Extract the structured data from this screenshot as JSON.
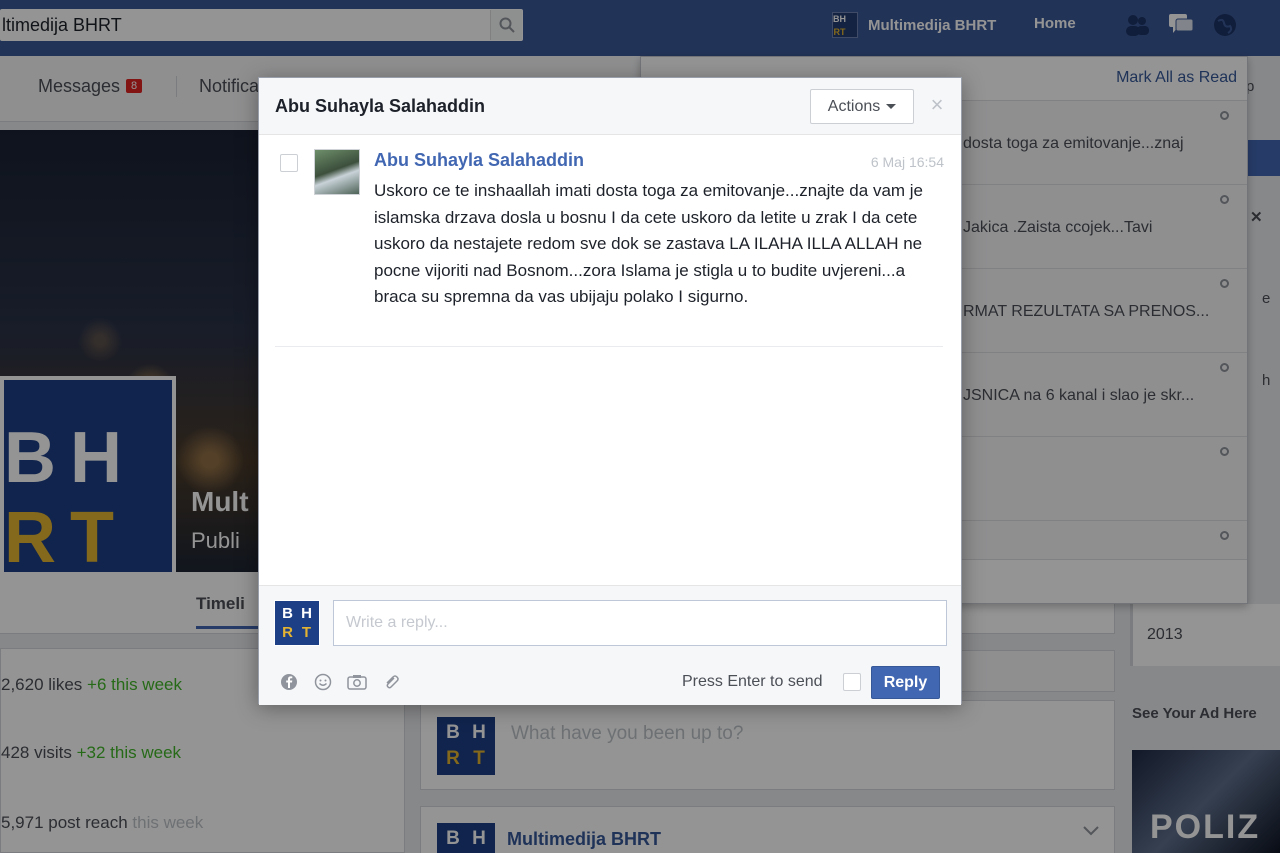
{
  "topbar": {
    "search_value": "ltimedija BHRT",
    "page_name": "Multimedija BHRT",
    "home_label": "Home",
    "accent": "#3b5998"
  },
  "subnav": {
    "messages_label": "Messages",
    "messages_badge": "8",
    "notifications_label": "Notifica"
  },
  "profile": {
    "logo_line1": "BH",
    "logo_line2": "RT",
    "name": "Mult",
    "category": "Publi",
    "tab_timeline": "Timeli"
  },
  "stats": {
    "likes": "2,620 likes",
    "likes_change": "+6 this week",
    "visits": "428 visits",
    "visits_change": "+32 this week",
    "reach": "5,971 post reach",
    "reach_change": "this week"
  },
  "notifications": {
    "mark_all_read": "Mark All as Read",
    "items": [
      {
        "text": "dosta toga za emitovanje...znaj"
      },
      {
        "text": "Jakica .Zaista ccojek...Tavi"
      },
      {
        "text": "RMAT REZULTATA SA PRENOS..."
      },
      {
        "text": "JSNICA na 6 kanal i slao je skr..."
      },
      {
        "text": ""
      },
      {
        "text": ""
      }
    ]
  },
  "right_column": {
    "partial_top": "p",
    "partial_x": "✕",
    "partial_e": "e",
    "partial_h": "h",
    "year": "2013",
    "ad_heading": "See Your Ad Here",
    "ad_text": "POLIZ"
  },
  "feed": {
    "composer_placeholder": "What have you been up to?",
    "post_author": "Multimedija BHRT"
  },
  "dialog": {
    "title": "Abu Suhayla Salahaddin",
    "actions_label": "Actions",
    "close_symbol": "×",
    "message": {
      "sender": "Abu Suhayla Salahaddin",
      "time": "6 Maj 16:54",
      "body": "Uskoro ce te inshaallah imati dosta toga za emitovanje...znajte da vam je islamska drzava dosla u bosnu I da cete uskoro da letite u zrak I da cete uskoro da nestajete redom sve dok se zastava LA ILAHA ILLA ALLAH ne pocne vijoriti nad Bosnom...zora Islama je stigla u to budite uvjereni...a braca su spremna da vas ubijaju polako I sigurno."
    },
    "reply_placeholder": "Write a reply...",
    "press_enter_label": "Press Enter to send",
    "reply_label": "Reply"
  },
  "icons": {
    "search": "search-icon",
    "friends": "friends-icon",
    "messages": "messages-icon",
    "globe": "globe-icon",
    "facebook": "facebook-icon",
    "emoji": "emoji-icon",
    "camera": "camera-icon",
    "attach": "paperclip-icon"
  }
}
